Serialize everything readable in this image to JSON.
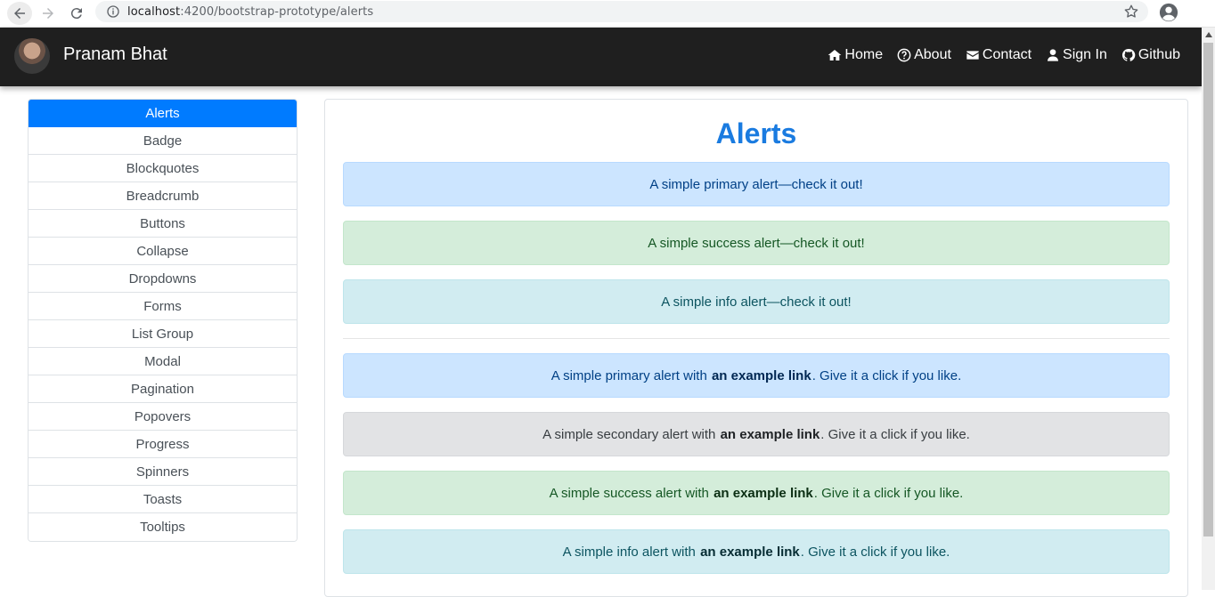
{
  "browser": {
    "url_host": "localhost",
    "url_rest": ":4200/bootstrap-prototype/alerts",
    "icons": [
      "back-arrow-icon",
      "forward-arrow-icon",
      "reload-icon",
      "info-icon",
      "star-icon",
      "profile-icon"
    ]
  },
  "navbar": {
    "brand": "Pranam Bhat",
    "links": [
      {
        "label": "Home",
        "icon": "home-icon"
      },
      {
        "label": "About",
        "icon": "question-circle-icon"
      },
      {
        "label": "Contact",
        "icon": "envelope-icon"
      },
      {
        "label": "Sign In",
        "icon": "user-icon"
      },
      {
        "label": "Github",
        "icon": "github-icon"
      }
    ]
  },
  "sidebar": {
    "items": [
      {
        "label": "Alerts",
        "active": true
      },
      {
        "label": "Badge"
      },
      {
        "label": "Blockquotes"
      },
      {
        "label": "Breadcrumb"
      },
      {
        "label": "Buttons"
      },
      {
        "label": "Collapse"
      },
      {
        "label": "Dropdowns"
      },
      {
        "label": "Forms"
      },
      {
        "label": "List Group"
      },
      {
        "label": "Modal"
      },
      {
        "label": "Pagination"
      },
      {
        "label": "Popovers"
      },
      {
        "label": "Progress"
      },
      {
        "label": "Spinners"
      },
      {
        "label": "Toasts"
      },
      {
        "label": "Tooltips"
      }
    ]
  },
  "main": {
    "title": "Alerts",
    "simple_alerts": [
      {
        "variant": "primary",
        "text": "A simple primary alert—check it out!"
      },
      {
        "variant": "success",
        "text": "A simple success alert—check it out!"
      },
      {
        "variant": "info",
        "text": "A simple info alert—check it out!"
      }
    ],
    "link_alerts": [
      {
        "variant": "primary",
        "before": "A simple primary alert with",
        "link": "an example link",
        "after": ". Give it a click if you like."
      },
      {
        "variant": "secondary",
        "before": "A simple secondary alert with",
        "link": "an example link",
        "after": ". Give it a click if you like."
      },
      {
        "variant": "success",
        "before": "A simple success alert with",
        "link": "an example link",
        "after": ". Give it a click if you like."
      },
      {
        "variant": "info",
        "before": "A simple info alert with",
        "link": "an example link",
        "after": ". Give it a click if you like."
      }
    ]
  },
  "colors": {
    "navbar_bg": "#1f1f1f",
    "active_item": "#007bff",
    "title": "#1a7be0"
  }
}
